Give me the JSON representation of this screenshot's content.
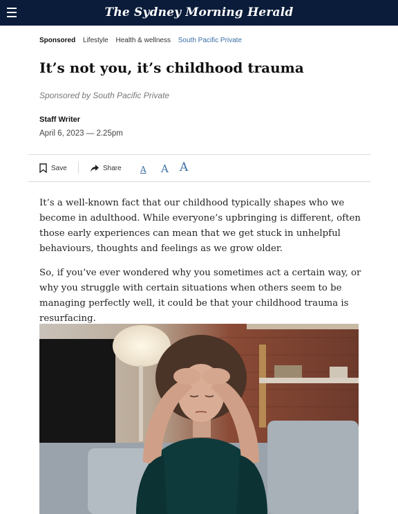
{
  "header": {
    "masthead": "The Sydney Morning Herald",
    "menu_icon": "hamburger-menu-icon"
  },
  "article": {
    "tags": [
      "Sponsored",
      "Lifestyle",
      "Health & wellness",
      "South Pacific Private"
    ],
    "headline": "It’s not you, it’s childhood trauma",
    "sponsored_by": "Sponsored by South Pacific Private",
    "author": "Staff Writer",
    "date": "April 6, 2023 — 2.25pm",
    "paragraphs": [
      "It’s a well-known fact that our childhood typically shapes who we become in adulthood. While everyone’s upbringing is different, often those early experiences can mean that we get stuck in unhelpful behaviours, thoughts and feelings as we grow older.",
      "So, if you’ve ever wondered why you sometimes act a certain way, or why you struggle with certain situations when others seem to be managing perfectly well, it could be that your childhood trauma is resurfacing."
    ]
  },
  "toolbar": {
    "save_label": "Save",
    "share_label": "Share",
    "font_sizes": [
      "A",
      "A",
      "A"
    ],
    "save_icon": "bookmark-icon",
    "share_icon": "share-arrow-icon"
  },
  "colors": {
    "masthead_bg": "#0b1c3a",
    "link": "#3a6ea5"
  }
}
